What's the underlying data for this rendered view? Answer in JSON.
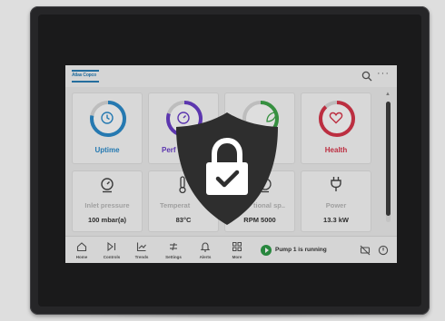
{
  "brand": {
    "logo_text": "Atlas Copco",
    "accent": "#2b7fb6"
  },
  "topbar": {
    "search_icon": "search-icon",
    "more_label": "···"
  },
  "status_tiles": [
    {
      "label": "Uptime",
      "color": "#2b8ccc",
      "icon": "clock-icon",
      "ring_fraction": 0.78
    },
    {
      "label": "Performance",
      "visible_label": "Perf",
      "color": "#6a3ec9",
      "icon": "gauge-icon",
      "ring_fraction": 0.8
    },
    {
      "label": "",
      "color": "#3fa64a",
      "icon": "leaf-icon",
      "ring_fraction": 0.6
    },
    {
      "label": "Health",
      "color": "#d8354a",
      "icon": "heart-icon",
      "ring_fraction": 0.88
    }
  ],
  "value_tiles": [
    {
      "name": "Inlet pressure",
      "value": "100 mbar(a)",
      "icon": "gauge-icon"
    },
    {
      "name": "Temperature",
      "visible_name": "Temperat",
      "value": "83°C",
      "icon": "thermometer-icon"
    },
    {
      "name": "Rotational speed",
      "visible_name": "tional sp..",
      "value": "RPM 5000",
      "icon": "speed-icon"
    },
    {
      "name": "Power",
      "value": "13.3 kW",
      "icon": "plug-icon"
    }
  ],
  "bottom_nav": [
    {
      "label": "Home",
      "icon": "home-icon"
    },
    {
      "label": "Controls",
      "icon": "controls-icon"
    },
    {
      "label": "Trends",
      "icon": "trends-icon"
    },
    {
      "label": "Settings",
      "icon": "settings-icon"
    },
    {
      "label": "Alerts",
      "icon": "bell-icon"
    },
    {
      "label": "More",
      "icon": "grid-icon"
    }
  ],
  "status": {
    "text": "Pump 1 is running",
    "color": "#2e9c48"
  },
  "overlay": {
    "icon": "lock-shield-icon",
    "color": "#2e2e2e"
  }
}
